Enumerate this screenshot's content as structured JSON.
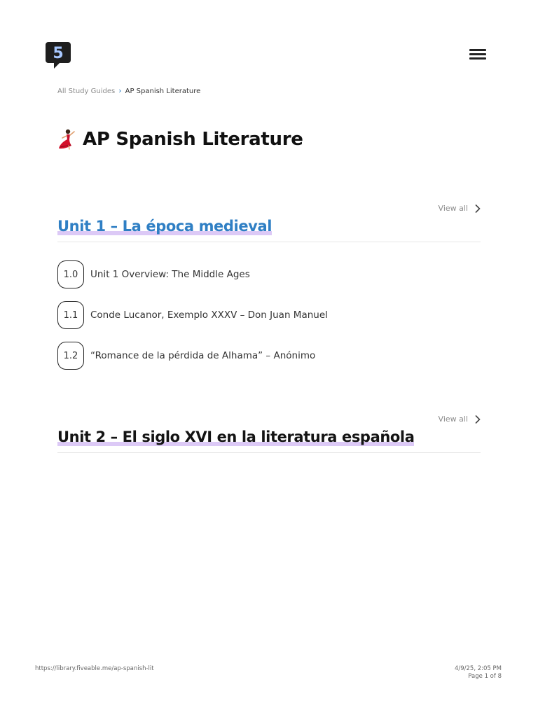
{
  "header": {
    "logo_text": "5",
    "menu_icon": "hamburger-icon"
  },
  "breadcrumb": {
    "items": [
      {
        "label": "All Study Guides"
      },
      {
        "label": "AP Spanish Literature"
      }
    ],
    "separator_icon": "chevron-right-icon"
  },
  "page": {
    "title": "AP Spanish Literature",
    "emoji_icon": "flamenco-dancer-icon"
  },
  "units": [
    {
      "title": "Unit 1 – La época medieval",
      "view_all": "View all",
      "topics": [
        {
          "number": "1.0",
          "title": "Unit 1 Overview: The Middle Ages"
        },
        {
          "number": "1.1",
          "title": "Conde Lucanor, Exemplo XXXV – Don Juan Manuel"
        },
        {
          "number": "1.2",
          "title": "“Romance de la pérdida de Alhama” – Anónimo"
        }
      ]
    },
    {
      "title": "Unit 2 – El siglo XVI en la literatura española",
      "view_all": "View all",
      "topics": []
    }
  ],
  "footer": {
    "url": "https://library.fiveable.me/ap-spanish-lit",
    "datetime": "4/9/25, 2:05 PM",
    "page_label": "Page 1 of 8"
  },
  "colors": {
    "accent_blue": "#2f7fc4",
    "highlight_purple": "#dcc9f6",
    "logo_dark": "#1e1e1e"
  }
}
